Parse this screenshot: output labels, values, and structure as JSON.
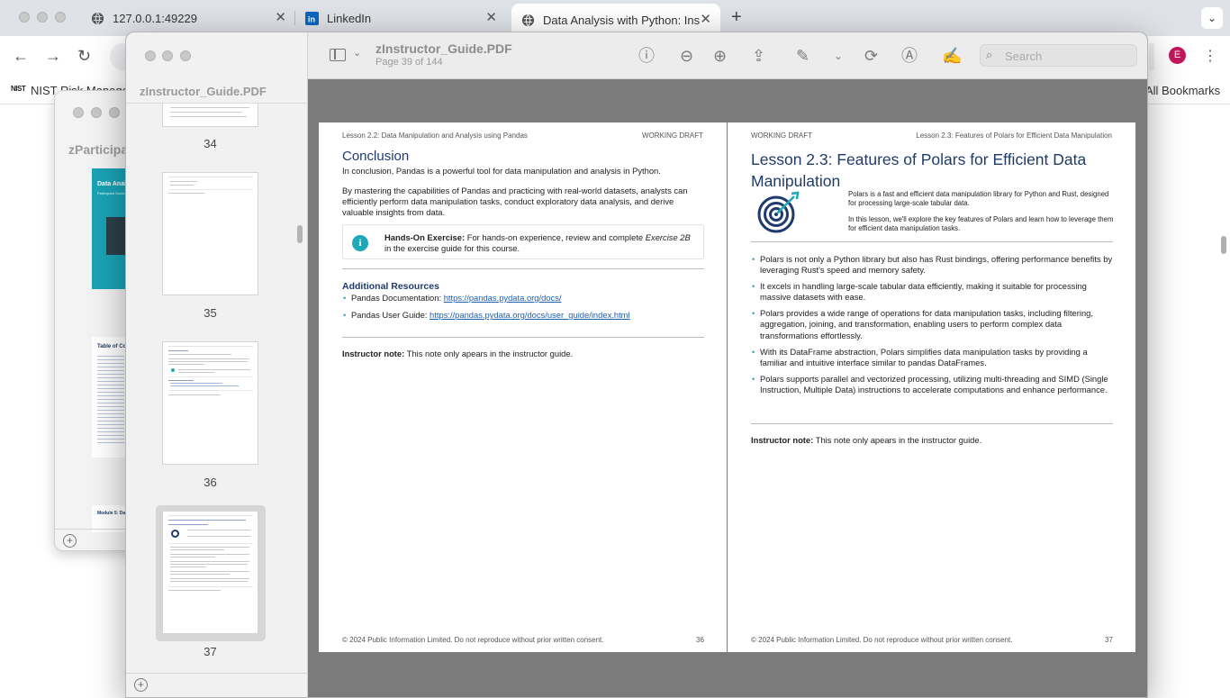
{
  "browser": {
    "tabs": [
      {
        "title": "127.0.0.1:49229",
        "icon": "globe-icon"
      },
      {
        "title": "LinkedIn",
        "icon": "linkedin-icon"
      },
      {
        "title": "Data Analysis with Python: Ins",
        "icon": "globe-icon"
      }
    ],
    "new_tab": "+",
    "profile_initial": "E",
    "bookmarks": {
      "first": "NIST Risk Manage",
      "all": "All Bookmarks",
      "nist": "NIST"
    }
  },
  "back_window": {
    "title": "zParticipa",
    "cover_title": "Data Anal",
    "cover_sub": "Participant Guide",
    "toc_title": "Table of Cont",
    "module_label": "Module 5: Da"
  },
  "preview": {
    "title": "zInstructor_Guide.PDF",
    "subtitle": "Page 39 of 144",
    "sidebar_title": "zInstructor_Guide.PDF",
    "search_placeholder": "Search",
    "thumbnails": [
      "34",
      "35",
      "36",
      "37"
    ],
    "selected_thumb": "37"
  },
  "page_left": {
    "header_left": "Lesson 2.2: Data Manipulation and Analysis using Pandas",
    "header_right": "WORKING DRAFT",
    "heading": "Conclusion",
    "para1": "In conclusion, Pandas is a powerful tool for data manipulation and analysis in Python.",
    "para2": "By mastering the capabilities of Pandas and practicing with real-world datasets, analysts can efficiently perform data manipulation tasks, conduct exploratory data analysis, and derive valuable insights from data.",
    "exercise_bold": "Hands-On Exercise:",
    "exercise_text": "For hands-on experience, review and complete",
    "exercise_italic": "Exercise 2B",
    "exercise_tail": "in the exercise guide for this course.",
    "resources_heading": "Additional Resources",
    "res1_label": "Pandas Documentation:",
    "res1_link": "https://pandas.pydata.org/docs/",
    "res2_label": "Pandas User Guide:",
    "res2_link": "https://pandas.pydata.org/docs/user_guide/index.html",
    "note_bold": "Instructor note:",
    "note_text": "This note only apears in the instructor guide.",
    "footer": "© 2024 Public Information Limited. Do not reproduce without prior written consent.",
    "page_number": "36"
  },
  "page_right": {
    "header_left": "WORKING DRAFT",
    "header_right": "Lesson 2.3: Features of Polars for Efficient Data Manipulation",
    "title": "Lesson 2.3: Features of Polars for Efficient Data Manipulation",
    "intro1": "Polars is a fast and efficient data manipulation library for Python and Rust, designed for processing large-scale tabular data.",
    "intro2": "In this lesson, we'll explore the key features of Polars and learn how to leverage them for efficient data manipulation tasks.",
    "bullets": [
      "Polars is not only a Python library but also has Rust bindings, offering performance benefits by leveraging Rust's speed and memory safety.",
      "It excels in handling large-scale tabular data efficiently, making it suitable for processing massive datasets with ease.",
      "Polars provides a wide range of operations for data manipulation tasks, including filtering, aggregation, joining, and transformation, enabling users to perform complex data transformations effortlessly.",
      "With its DataFrame abstraction, Polars simplifies data manipulation tasks by providing a familiar and intuitive interface similar to pandas DataFrames.",
      "Polars supports parallel and vectorized processing, utilizing multi-threading and SIMD (Single Instruction, Multiple Data) instructions to accelerate computations and enhance performance."
    ],
    "note_bold": "Instructor note:",
    "note_text": "This note only apears in the instructor guide.",
    "footer": "© 2024 Public Information Limited. Do not reproduce without prior written consent.",
    "page_number": "37"
  }
}
